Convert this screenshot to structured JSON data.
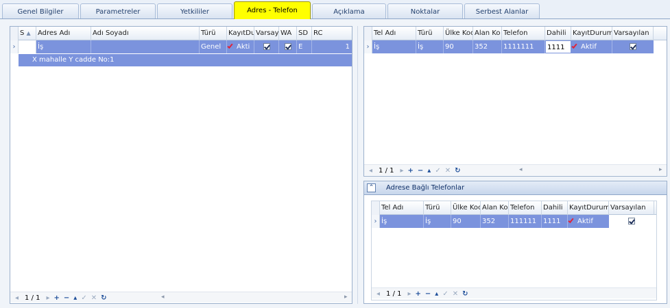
{
  "tabs": [
    {
      "label": "Genel Bilgiler"
    },
    {
      "label": "Parametreler"
    },
    {
      "label": "Yetkililer"
    },
    {
      "label": "Adres - Telefon"
    },
    {
      "label": "Açıklama"
    },
    {
      "label": "Noktalar"
    },
    {
      "label": "Serbest Alanlar"
    }
  ],
  "address_grid": {
    "columns": [
      "S",
      "Adres Adı",
      "Adı Soyadı",
      "Türü",
      "KayıtDu",
      "Varsay",
      "WA",
      "SD",
      "RC"
    ],
    "row": {
      "adres_adi": "İş",
      "adi_soyadi": "",
      "turu": "Genel",
      "kayit_durumu": "Akti",
      "sd": "E",
      "rc": "1"
    },
    "detail": "X mahalle Y cadde No:1",
    "navigator": {
      "pager": "1 / 1"
    }
  },
  "phone_grid": {
    "columns": [
      "Tel Adı",
      "Türü",
      "Ülke Koc",
      "Alan Ko",
      "Telefon",
      "Dahili",
      "KayıtDurumu",
      "Varsayılan"
    ],
    "row": {
      "tel_adi": "İş",
      "turu": "İş",
      "ulke_kodu": "90",
      "alan_kodu": "352",
      "telefon": "1111111",
      "dahili": "1111",
      "kayit_durumu": "Aktif"
    },
    "navigator": {
      "pager": "1 / 1"
    }
  },
  "linked_phones": {
    "title": "Adrese Bağlı Telefonlar",
    "columns": [
      "Tel Adı",
      "Türü",
      "Ülke Koc",
      "Alan Ko",
      "Telefon",
      "Dahili",
      "KayıtDurumu",
      "Varsayılan"
    ],
    "row": {
      "tel_adi": "İş",
      "turu": "İş",
      "ulke_kodu": "90",
      "alan_kodu": "352",
      "telefon": "111111",
      "dahili": "1111",
      "kayit_durumu": "Aktif"
    },
    "navigator": {
      "pager": "1 / 1"
    }
  },
  "colors": {
    "active_tab": "#ffff00",
    "selected_row": "#7b93dd",
    "nav_button": "#1f4f9a"
  }
}
